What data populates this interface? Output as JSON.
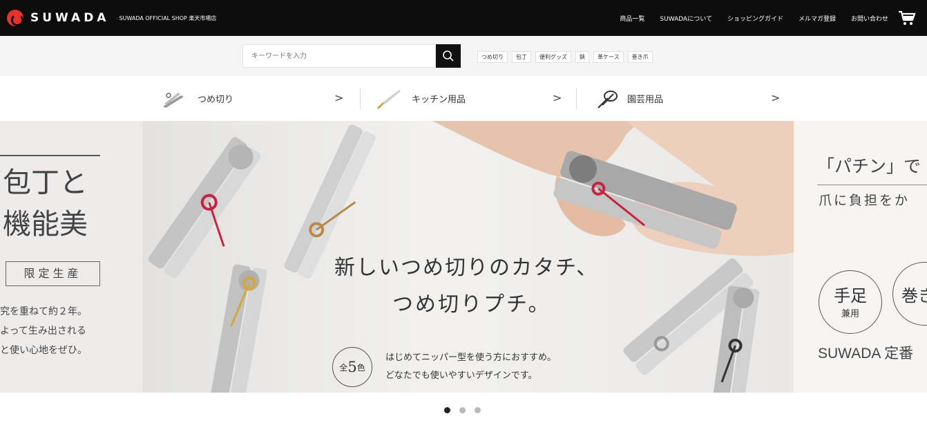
{
  "header": {
    "brand": "SUWADA",
    "shop_name": "SUWADA OFFICIAL SHOP 楽天市場店",
    "nav": [
      "商品一覧",
      "SUWADAについて",
      "ショッピングガイド",
      "メルマガ登録",
      "お問い合わせ"
    ]
  },
  "search": {
    "placeholder": "キーワードを入力",
    "tags": [
      "つめ切り",
      "包丁",
      "便利グッズ",
      "鋏",
      "革ケース",
      "巻き爪"
    ]
  },
  "categories": [
    {
      "label": "つめ切り",
      "icon": "nail-clipper-icon"
    },
    {
      "label": "キッチン用品",
      "icon": "kitchen-knife-icon"
    },
    {
      "label": "園芸用品",
      "icon": "garden-shears-icon"
    }
  ],
  "slide_left": {
    "title_line1": "包丁と",
    "title_line2": "機能美",
    "badge": "限定生産",
    "body": [
      "究を重ねて約２年。",
      "よって生み出される",
      "と使い心地をぜひ。"
    ]
  },
  "slide_main": {
    "headline_line1": "新しいつめ切りのカタチ、",
    "headline_line2": "つめ切りプチ。",
    "badge_prefix": "全",
    "badge_number": "5",
    "badge_suffix": "色",
    "sub_line1": "はじめてニッパー型を使う方におすすめ。",
    "sub_line2": "どなたでも使いやすいデザインです。"
  },
  "slide_right": {
    "title": "「パチン」で",
    "subtitle": "爪に負担をか",
    "circle1_main": "手足",
    "circle1_sub": "兼用",
    "circle2_main": "巻き",
    "footer": "SUWADA 定番"
  },
  "carousel": {
    "total": 3,
    "active": 1
  },
  "colors": {
    "topbar": "#0d0d0d",
    "brand_red": "#e6322a",
    "accent_red": "#c8233e",
    "gold": "#c9a04a"
  }
}
